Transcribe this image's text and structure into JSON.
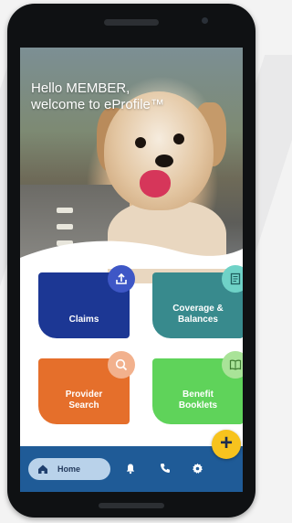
{
  "hero": {
    "greeting_line1": "Hello MEMBER,",
    "greeting_line2": "welcome to eProfile™"
  },
  "tiles": [
    {
      "label": "Claims",
      "icon": "upload-icon",
      "color": "#1c3794"
    },
    {
      "label_line1": "Coverage &",
      "label_line2": "Balances",
      "icon": "document-icon",
      "color": "#388a8d"
    },
    {
      "label_line1": "Provider",
      "label_line2": "Search",
      "icon": "search-icon",
      "color": "#e56f2b"
    },
    {
      "label_line1": "Benefit",
      "label_line2": "Booklets",
      "icon": "book-icon",
      "color": "#5fd35a"
    }
  ],
  "fab": {
    "label": "+",
    "color": "#f7c31e"
  },
  "nav": {
    "home_label": "Home",
    "items": [
      "home-icon",
      "bell-icon",
      "phone-icon",
      "gear-icon"
    ],
    "color": "#1f5b97"
  }
}
